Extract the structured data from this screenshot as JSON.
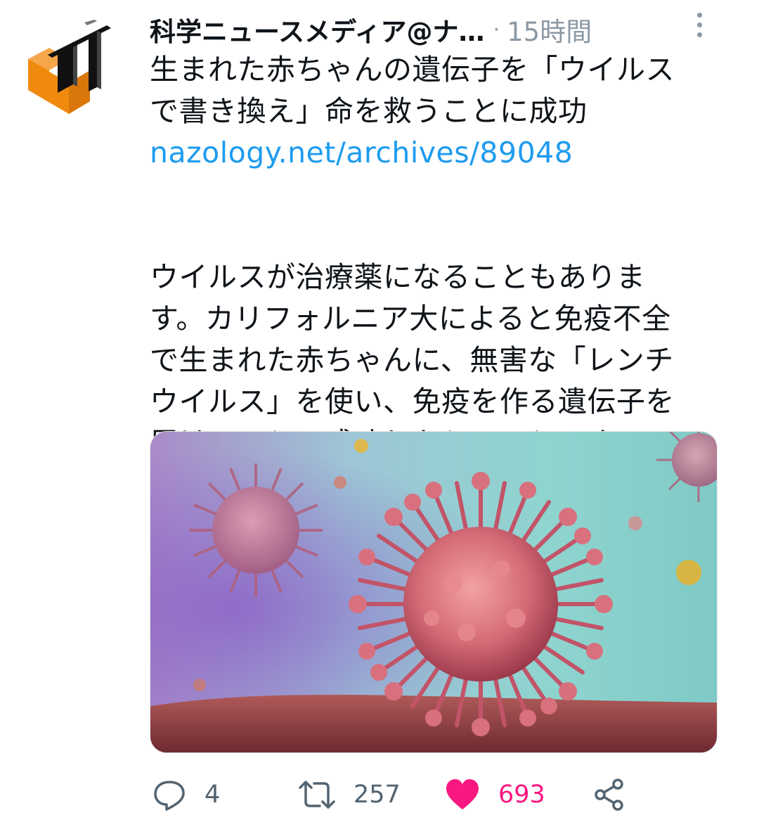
{
  "tweet": {
    "display_name": "科学ニュースメディア@ナ…",
    "separator": "·",
    "timestamp": "15時間",
    "headline_lines": [
      "生まれた赤ちゃんの遺伝子を「ウイルス",
      "で書き換え」命を救うことに成功"
    ],
    "link": "nazology.net/archives/89048",
    "body_lines": [
      "ウイルスが治療薬になることもありま",
      "す。カリフォルニア大によると免疫不全",
      "で生まれた赤ちゃんに、無害な「レンチ",
      "ウイルス」を使い、免疫を作る遺伝子を",
      "届けることに成功したとのことです。"
    ]
  },
  "media": {
    "image": "virus-illustration"
  },
  "actions": {
    "reply_count": "4",
    "retweet_count": "257",
    "like_count": "693",
    "icons": {
      "reply": "reply-icon",
      "retweet": "retweet-icon",
      "like": "heart-icon",
      "share": "share-icon"
    }
  },
  "colors": {
    "link": "#1d9bf0",
    "like": "#f91880",
    "muted": "#8b98a5",
    "avatar_orange": "#f08a0f"
  }
}
